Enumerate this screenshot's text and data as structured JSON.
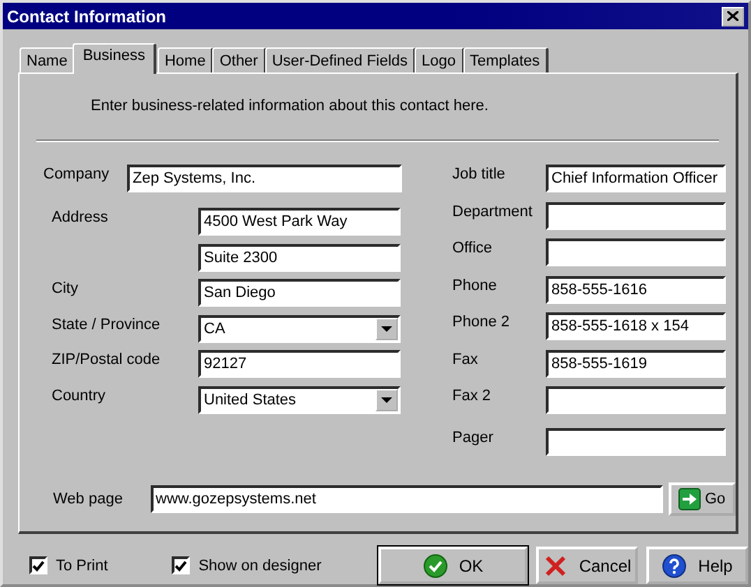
{
  "window": {
    "title": "Contact Information"
  },
  "tabs": [
    {
      "label": "Name",
      "selected": false
    },
    {
      "label": "Business",
      "selected": true
    },
    {
      "label": "Home",
      "selected": false
    },
    {
      "label": "Other",
      "selected": false
    },
    {
      "label": "User-Defined Fields",
      "selected": false
    },
    {
      "label": "Logo",
      "selected": false
    },
    {
      "label": "Templates",
      "selected": false
    }
  ],
  "intro": "Enter business-related information about this contact here.",
  "company": {
    "label": "Company",
    "value": "Zep Systems, Inc."
  },
  "left_fields": [
    {
      "label": "Address",
      "value": "4500 West Park Way",
      "kind": "text"
    },
    {
      "value": "Suite 2300",
      "kind": "text"
    },
    {
      "label": "City",
      "value": "San Diego",
      "kind": "text"
    },
    {
      "label": "State / Province",
      "value": "CA",
      "kind": "dropdown"
    },
    {
      "label": "ZIP/Postal code",
      "value": "92127",
      "kind": "text"
    },
    {
      "label": "Country",
      "value": "United States",
      "kind": "dropdown"
    }
  ],
  "right_fields": [
    {
      "label": "Job title",
      "value": "Chief Information Officer"
    },
    {
      "label": "Department"
    },
    {
      "label": "Office"
    },
    {
      "label": "Phone",
      "value": "858-555-1616"
    },
    {
      "label": "Phone 2",
      "value": "858-555-1618 x 154"
    },
    {
      "label": "Fax",
      "value": "858-555-1619"
    },
    {
      "label": "Fax 2"
    },
    {
      "label": "Pager"
    }
  ],
  "web_page": {
    "label": "Web page",
    "value": "www.gozepsystems.net",
    "button": "Go"
  },
  "options": [
    {
      "label": "To Print",
      "checked": true
    },
    {
      "label": "Show on designer",
      "checked": true
    }
  ],
  "buttons": [
    {
      "label": "OK",
      "kind": "ok"
    },
    {
      "label": "Cancel",
      "kind": "cancel"
    },
    {
      "label": "Help",
      "kind": "help"
    }
  ]
}
